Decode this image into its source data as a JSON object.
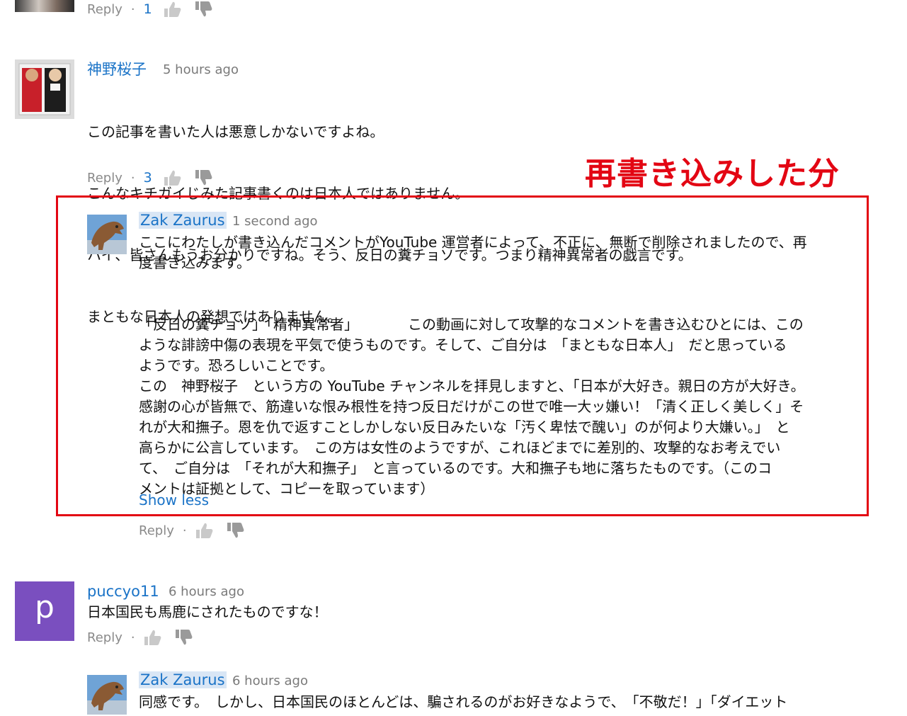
{
  "colors": {
    "link": "#1a73c7",
    "meta": "#7a7a7a",
    "annotation": "#e30613",
    "avatar_purple": "#7a4fbf"
  },
  "top_reply_bar": {
    "reply": "Reply",
    "dot": "·",
    "likes": "1"
  },
  "comment1": {
    "author": "神野桜子",
    "time": "5 hours ago",
    "lines": [
      "この記事を書いた人は悪意しかないですよね。",
      "こんなキチガイじみた記事書くのは日本人ではありません。",
      "ハイ、皆さんもうお分かりですね。そう、反日の糞チョソです。つまり精神異常者の戯言です。",
      "まともな日本人の発想ではありません。"
    ],
    "reply": "Reply",
    "dot": "·",
    "likes": "3"
  },
  "annotation": {
    "label": "再書き込みした分"
  },
  "comment2": {
    "author": "Zak Zaurus",
    "time": "1 second ago",
    "para1": "ここにわたしが書き込んだコメントがYouTube 運営者によって、不正に、無断で削除されましたので、再\n度書き込みます。",
    "para2": "「反日の糞チョソ」「精神異常者」　　　　この動画に対して攻撃的なコメントを書き込むひとには、この\nような誹謗中傷の表現を平気で使うものです。そして、ご自分は　「まともな日本人」　だと思っている\nようです。恐ろしいことです。\nこの　神野桜子　という方の YouTube チャンネルを拝見しますと、「日本が大好き。親日の方が大好き。\n感謝の心が皆無で、筋違いな恨み根性を持つ反日だけがこの世で唯一大ッ嫌い！「清く正しく美しく」そ\nれが大和撫子。恩を仇で返すことしかしない反日みたいな「汚く卑怯で醜い」のが何より大嫌い。」　と\n高らかに公言しています。　この方は女性のようですが、これほどまでに差別的、攻撃的なお考えでい\nて、　ご自分は　「それが大和撫子」　と言っているのです。大和撫子も地に落ちたものです。（このコ\nメントは証拠として、コピーを取っています）",
    "show_less": "Show less",
    "reply": "Reply",
    "dot": "·"
  },
  "comment3": {
    "avatar_letter": "p",
    "author": "puccyo11",
    "time": "6 hours ago",
    "text": "日本国民も馬鹿にされたものですな！",
    "reply": "Reply",
    "dot": "·"
  },
  "comment4": {
    "author": "Zak Zaurus",
    "time": "6 hours ago",
    "text": "同感です。　しかし、日本国民のほとんどは、騙されるのがお好きなようで、　「不敬だ！」「ダイエット"
  }
}
